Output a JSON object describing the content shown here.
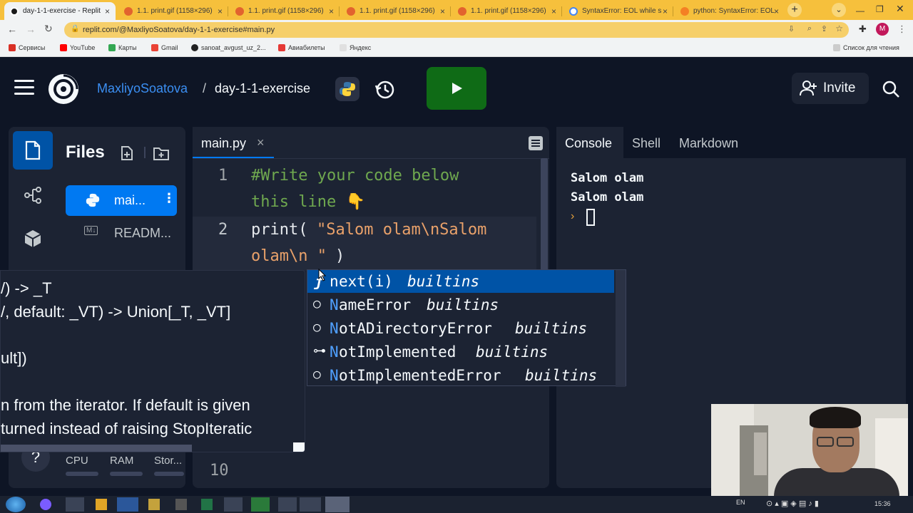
{
  "browser": {
    "tabs": [
      {
        "title": "day-1-1-exercise - Replit",
        "active": true,
        "icon_color": "#1a1a1a"
      },
      {
        "title": "1.1. print.gif (1158×296)",
        "active": false,
        "icon_color": "#e2632e"
      },
      {
        "title": "1.1. print.gif (1158×296)",
        "active": false,
        "icon_color": "#e2632e"
      },
      {
        "title": "1.1. print.gif (1158×296)",
        "active": false,
        "icon_color": "#e2632e"
      },
      {
        "title": "1.1. print.gif (1158×296)",
        "active": false,
        "icon_color": "#e2632e"
      },
      {
        "title": "SyntaxError: EOL while s",
        "active": false,
        "icon_color": "#4285f4"
      },
      {
        "title": "python: SyntaxError: EOL",
        "active": false,
        "icon_color": "#f48024"
      }
    ],
    "url": "replit.com/@MaxliyoSoatova/day-1-1-exercise#main.py",
    "profile_initial": "M",
    "bookmarks": [
      {
        "label": "Сервисы",
        "color": "#d93025"
      },
      {
        "label": "YouTube",
        "color": "#ff0000"
      },
      {
        "label": "Карты",
        "color": "#34a853"
      },
      {
        "label": "Gmail",
        "color": "#ea4335"
      },
      {
        "label": "sanoat_avgust_uz_2...",
        "color": "#222222"
      },
      {
        "label": "Авиабилеты",
        "color": "#e53935"
      },
      {
        "label": "Яндекс",
        "color": "#e0e0e0"
      }
    ],
    "reading_list": "Список для чтения"
  },
  "header": {
    "user": "MaxliyoSoatova",
    "separator": "/",
    "repl_name": "day-1-1-exercise",
    "invite_label": "Invite"
  },
  "sidebar": {
    "title": "Files",
    "files": [
      {
        "name": "mai...",
        "active": true
      },
      {
        "name": "READM...",
        "active": false
      }
    ],
    "resources": {
      "cpu": "CPU",
      "ram": "RAM",
      "storage": "Stor..."
    },
    "help": "?"
  },
  "editor": {
    "tab": "main.py",
    "close": "×",
    "lines": [
      {
        "num": "1",
        "text": "#Write your code below",
        "cont": "this line 👇",
        "type": "comment"
      },
      {
        "num": "2",
        "fn": "print(",
        "str": "\"Salom olam\\nSalom",
        "cont": "olam\\n \"",
        "close": ")",
        "type": "code"
      }
    ],
    "last_line_num": "10"
  },
  "tooltip": {
    "lines": [
      "/) -> _T",
      "/, default: _VT) -> Union[_T, _VT]",
      "",
      "ult])",
      "",
      "n from the iterator. If default is given",
      "turned instead of raising StopIteratic"
    ]
  },
  "autocomplete": {
    "items": [
      {
        "prefix": "N",
        "rest": "ext(i)",
        "hint": "builtins",
        "icon": "function-icon",
        "glyph": "ƒ",
        "selected": true,
        "prefix_lower": "n"
      },
      {
        "prefix": "N",
        "rest": "ameError",
        "hint": "builtins",
        "icon": "class-icon",
        "glyph": "○",
        "selected": false
      },
      {
        "prefix": "N",
        "rest": "otADirectoryError",
        "hint": "builtins",
        "icon": "class-icon",
        "glyph": "○",
        "selected": false
      },
      {
        "prefix": "N",
        "rest": "otImplemented",
        "hint": "builtins",
        "icon": "key-icon",
        "glyph": "⊶",
        "selected": false
      },
      {
        "prefix": "N",
        "rest": "otImplementedError",
        "hint": "builtins",
        "icon": "class-icon",
        "glyph": "○",
        "selected": false
      }
    ]
  },
  "console": {
    "tabs": [
      "Console",
      "Shell",
      "Markdown"
    ],
    "output": [
      "Salom olam",
      "Salom olam"
    ],
    "prompt": "›"
  },
  "taskbar": {
    "lang": "EN",
    "time": "15:36"
  },
  "colors": {
    "accent_blue": "#0079f2",
    "run_green": "#0f6b16",
    "comment_green": "#6fa84f",
    "string_orange": "#e9a16a",
    "bg": "#0e1525",
    "panel": "#1c2333"
  }
}
